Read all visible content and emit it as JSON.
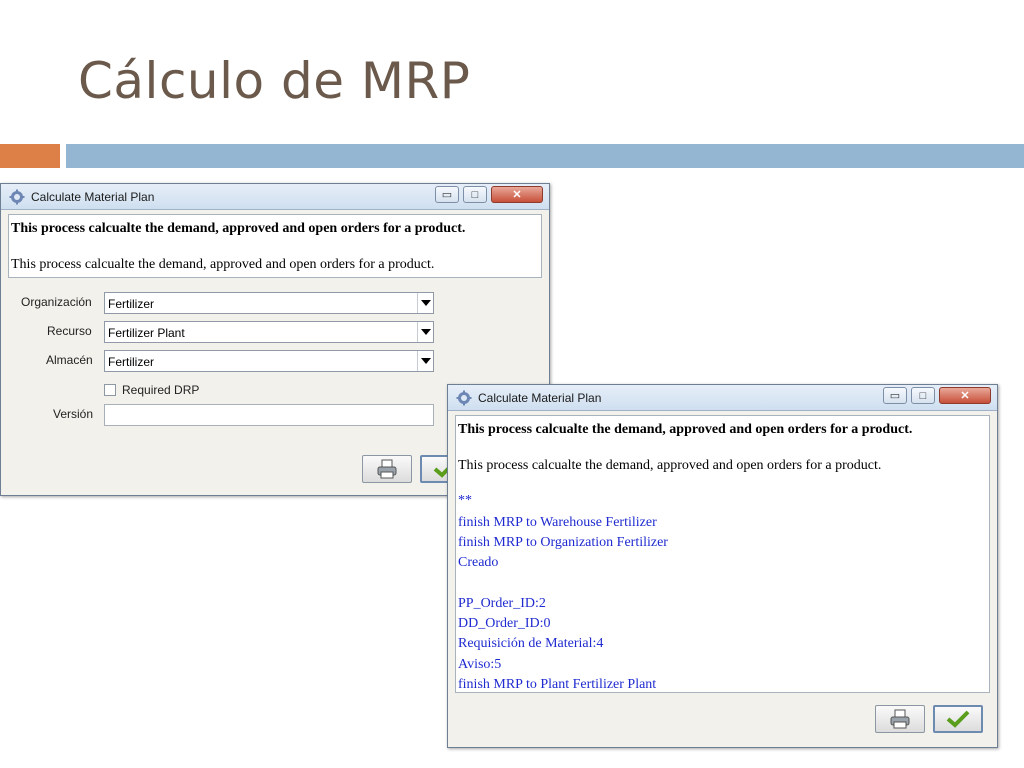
{
  "slide": {
    "title": "Cálculo de MRP"
  },
  "window1": {
    "title": "Calculate Material Plan",
    "controls": {
      "minimize": "▭",
      "maximize": "□",
      "close": "✕"
    },
    "header": {
      "bold": "This process calcualte the demand, approved and open orders for a product.",
      "normal": "This process calcualte the demand, approved and open orders for a product."
    },
    "fields": {
      "organizacion": {
        "label": "Organización",
        "value": "Fertilizer"
      },
      "recurso": {
        "label": "Recurso",
        "value": "Fertilizer Plant"
      },
      "almacen": {
        "label": "Almacén",
        "value": "Fertilizer"
      },
      "required_drp": {
        "label": "Required DRP",
        "checked": false
      },
      "version": {
        "label": "Versión",
        "value": ""
      }
    }
  },
  "window2": {
    "title": "Calculate Material Plan",
    "controls": {
      "minimize": "▭",
      "maximize": "□",
      "close": "✕"
    },
    "header": {
      "bold": "This process calcualte the demand, approved and open orders for a product.",
      "normal": "This process calcualte the demand, approved and open orders for a product."
    },
    "log": [
      "**",
      "finish MRP to Warehouse Fertilizer",
      "finish MRP to Organization Fertilizer",
      "Creado",
      "",
      "PP_Order_ID:2",
      "DD_Order_ID:0",
      "Requisición de Material:4",
      "Aviso:5",
      "finish MRP to Plant Fertilizer Plant"
    ]
  },
  "icons": {
    "window": "gear-icon",
    "print": "print-icon",
    "ok": "checkmark-icon",
    "dropdown": "chevron-down-icon"
  },
  "colors": {
    "accent_orange": "#dd8047",
    "accent_blue": "#94b6d2",
    "log_text": "#1f2bd0",
    "title_text": "#6b5a4c"
  }
}
